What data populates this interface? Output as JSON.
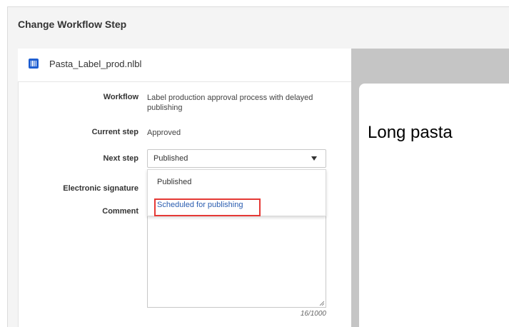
{
  "dialog": {
    "title": "Change Workflow Step"
  },
  "file": {
    "name": "Pasta_Label_prod.nlbl",
    "icon": "barcode-file-icon"
  },
  "form": {
    "workflow_label": "Workflow",
    "workflow_value": "Label production approval process with delayed publishing",
    "current_step_label": "Current step",
    "current_step_value": "Approved",
    "next_step_label": "Next step",
    "next_step_value": "Published",
    "esig_label": "Electronic signature",
    "comment_label": "Comment",
    "comment_counter": "16/1000"
  },
  "dropdown": {
    "options": [
      "Published",
      "Scheduled for publishing"
    ],
    "highlighted_index": 1
  },
  "preview": {
    "label_text": "Long pasta"
  },
  "colors": {
    "accent_blue": "#1f5fd1",
    "link_blue": "#2a5db0",
    "highlight_red": "#e53935",
    "preview_bg": "#c5c5c5"
  }
}
